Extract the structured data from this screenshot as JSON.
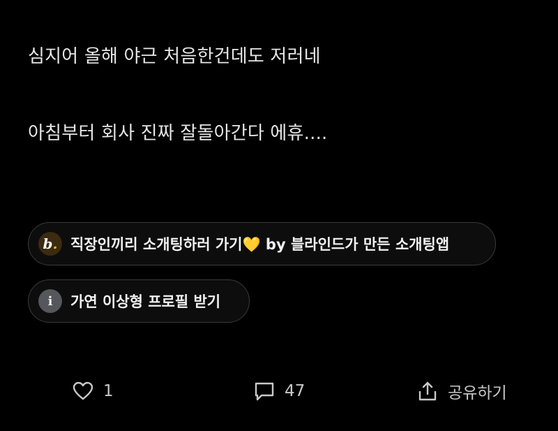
{
  "post": {
    "lines": [
      "심지어 올해 야근 처음한건데도 저러네",
      "아침부터 회사 진짜 잘돌아간다 에휴...."
    ]
  },
  "promo_chips": [
    {
      "badge_letter": "b",
      "badge_dot": ".",
      "badge_icon": "blind-b-logo-icon",
      "text": "직장인끼리 소개팅하러 가기💛 by 블라인드가 만든 소개팅앱"
    },
    {
      "badge_letter": "i",
      "badge_icon": "info-icon",
      "text": "가연 이상형 프로필 받기"
    }
  ],
  "actions": {
    "like": {
      "icon": "heart-icon",
      "count": "1"
    },
    "comment": {
      "icon": "comment-icon",
      "count": "47"
    },
    "share": {
      "icon": "share-icon",
      "label": "공유하기"
    }
  },
  "colors": {
    "background": "#000000",
    "text": "#e6e6e6",
    "chip_border": "#3a3a3a",
    "brand_dot": "#f2b21c",
    "action_text": "#c9c9c9"
  }
}
